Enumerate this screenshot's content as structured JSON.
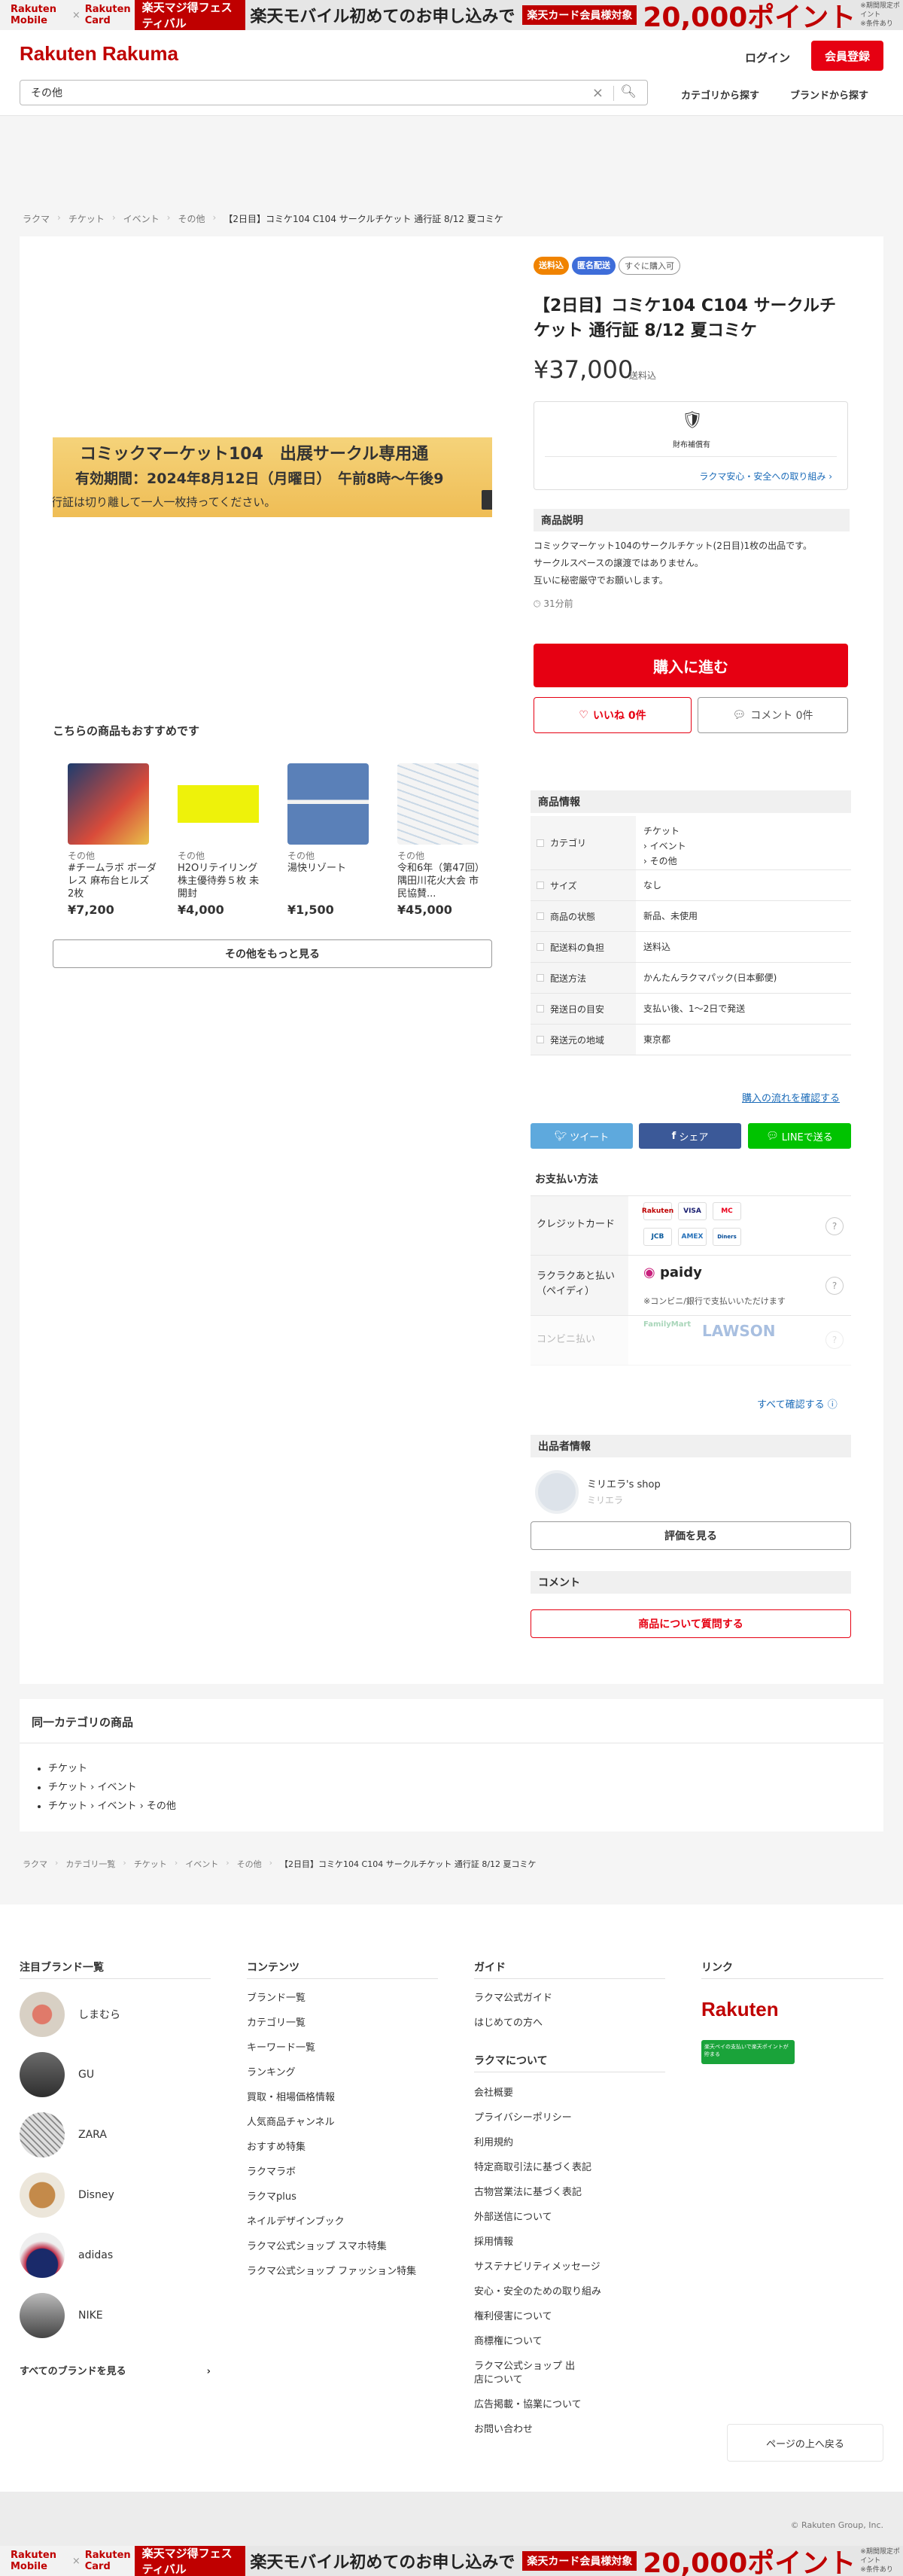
{
  "promo": {
    "brand1": "Rakuten Mobile",
    "brand2": "Rakuten Card",
    "festival": "楽天マジ得フェスティバル",
    "mobile_text": "楽天モバイル初めてのお申し込みで",
    "card_text": "楽天カード会員様対象",
    "points": "20,000ポイント",
    "note1": "※期間限定ポイント",
    "note2": "※条件あり"
  },
  "header": {
    "logo_main": "Rakuten",
    "logo_sub": "Rakuma",
    "login": "ログイン",
    "register": "会員登録",
    "search_value": "その他",
    "nav_category": "カテゴリから探す",
    "nav_brand": "ブランドから探す"
  },
  "breadcrumb": [
    "ラクマ",
    "チケット",
    "イベント",
    "その他",
    "【2日目】コミケ104 C104 サークルチケット 通行証 8/12 夏コミケ"
  ],
  "product": {
    "badges": [
      "送料込",
      "匿名配送",
      "すぐに購入可"
    ],
    "title": "【2日目】コミケ104 C104 サークルチケット 通行証 8/12 夏コミケ",
    "price": "¥37,000",
    "shipping": "送料込",
    "image": {
      "line1": "コミックマーケット104　出展サークル専用通",
      "line2": "有効期間：2024年8月12日（月曜日）　午前8時〜午後9",
      "line3": "行証は切り離して一人一枚持ってください。"
    },
    "safe": {
      "label": "財布補償有",
      "link": "ラクマ安心・安全への取り組み"
    },
    "desc_title": "商品説明",
    "desc_lines": [
      "コミックマーケット104のサークルチケット(2日目)1枚の出品です。",
      "サークルスペースの譲渡ではありません。",
      "互いに秘密厳守でお願いします。"
    ],
    "posted": "31分前",
    "buy": "購入に進む",
    "like": "いいね 0件",
    "comment": "コメント 0件"
  },
  "recommend": {
    "title": "こちらの商品もおすすめです",
    "items": [
      {
        "cat": "その他",
        "name": "#チームラボ ボーダレス 麻布台ヒルズ　2枚",
        "price": "¥7,200"
      },
      {
        "cat": "その他",
        "name": "H2Oリテイリング 株主優待券５枚 未開封",
        "price": "¥4,000"
      },
      {
        "cat": "その他",
        "name": "湯快リゾート",
        "price": "¥1,500"
      },
      {
        "cat": "その他",
        "name": "令和6年（第47回）隅田川花火大会 市民協賛...",
        "price": "¥45,000"
      }
    ],
    "more": "その他をもっと見る"
  },
  "info": {
    "title": "商品情報",
    "rows": [
      {
        "k": "カテゴリ",
        "v": [
          "チケット",
          "› イベント",
          "› その他"
        ]
      },
      {
        "k": "サイズ",
        "v": [
          "なし"
        ]
      },
      {
        "k": "商品の状態",
        "v": [
          "新品、未使用"
        ]
      },
      {
        "k": "配送料の負担",
        "v": [
          "送料込"
        ]
      },
      {
        "k": "配送方法",
        "v": [
          "かんたんラクマパック(日本郵便)"
        ]
      },
      {
        "k": "発送日の目安",
        "v": [
          "支払い後、1〜2日で発送"
        ]
      },
      {
        "k": "発送元の地域",
        "v": [
          "東京都"
        ]
      }
    ],
    "flow_link": "購入の流れを確認する"
  },
  "share": {
    "tweet": "ツイート",
    "facebook": "シェア",
    "line": "LINEで送る"
  },
  "payment": {
    "title": "お支払い方法",
    "credit": "クレジットカード",
    "card_labels": [
      "Rakuten",
      "VISA",
      "MC",
      "JCB",
      "AMEX",
      "Diners"
    ],
    "atobarai": "ラクラクあと払い（ペイディ）",
    "paidy": "paidy",
    "paidy_note": "※コンビニ/銀行で支払いいただけます",
    "konbini": "コンビニ払い",
    "konbini_labels": [
      "FamilyMart",
      "LAWSON"
    ],
    "all_link": "すべて確認する"
  },
  "seller": {
    "title": "出品者情報",
    "name": "ミリエラ's shop",
    "sub": "ミリエラ",
    "review": "評価を見る"
  },
  "comments": {
    "title": "コメント",
    "ask": "商品について質問する"
  },
  "samecat": {
    "title": "同一カテゴリの商品",
    "items": [
      "チケット",
      "チケット › イベント",
      "チケット › イベント › その他"
    ]
  },
  "breadcrumb2": [
    "ラクマ",
    "カテゴリ一覧",
    "チケット",
    "イベント",
    "その他",
    "【2日目】コミケ104 C104 サークルチケット 通行証 8/12 夏コミケ"
  ],
  "footer": {
    "brands_title": "注目ブランド一覧",
    "brands": [
      "しまむら",
      "GU",
      "ZARA",
      "Disney",
      "adidas",
      "NIKE"
    ],
    "brands_all": "すべてのブランドを見る",
    "contents_title": "コンテンツ",
    "contents": [
      "ブランド一覧",
      "カテゴリ一覧",
      "キーワード一覧",
      "ランキング",
      "買取・相場価格情報",
      "人気商品チャンネル",
      "おすすめ特集",
      "ラクマラボ",
      "ラクマplus",
      "ネイルデザインブック",
      "ラクマ公式ショップ スマホ特集",
      "ラクマ公式ショップ ファッション特集"
    ],
    "guide_title": "ガイド",
    "guide": [
      "ラクマ公式ガイド",
      "はじめての方へ"
    ],
    "about_title": "ラクマについて",
    "about": [
      "会社概要",
      "プライバシーポリシー",
      "利用規約",
      "特定商取引法に基づく表記",
      "古物営業法に基づく表記",
      "外部送信について",
      "採用情報",
      "サステナビリティメッセージ",
      "安心・安全のための取り組み",
      "権利侵害について",
      "商標権について",
      "ラクマ公式ショップ 出店について",
      "広告掲載・協業について",
      "お問い合わせ"
    ],
    "link_title": "リンク",
    "link_rakuten": "Rakuten",
    "link_pay": "楽天ペイの支払いで楽天ポイントが貯まる",
    "pagetop": "ページの上へ戻る",
    "copyright": "© Rakuten Group, Inc."
  },
  "colors": {
    "accent": "#bf0000",
    "buy": "#e60012",
    "link": "#1b6bb8"
  }
}
